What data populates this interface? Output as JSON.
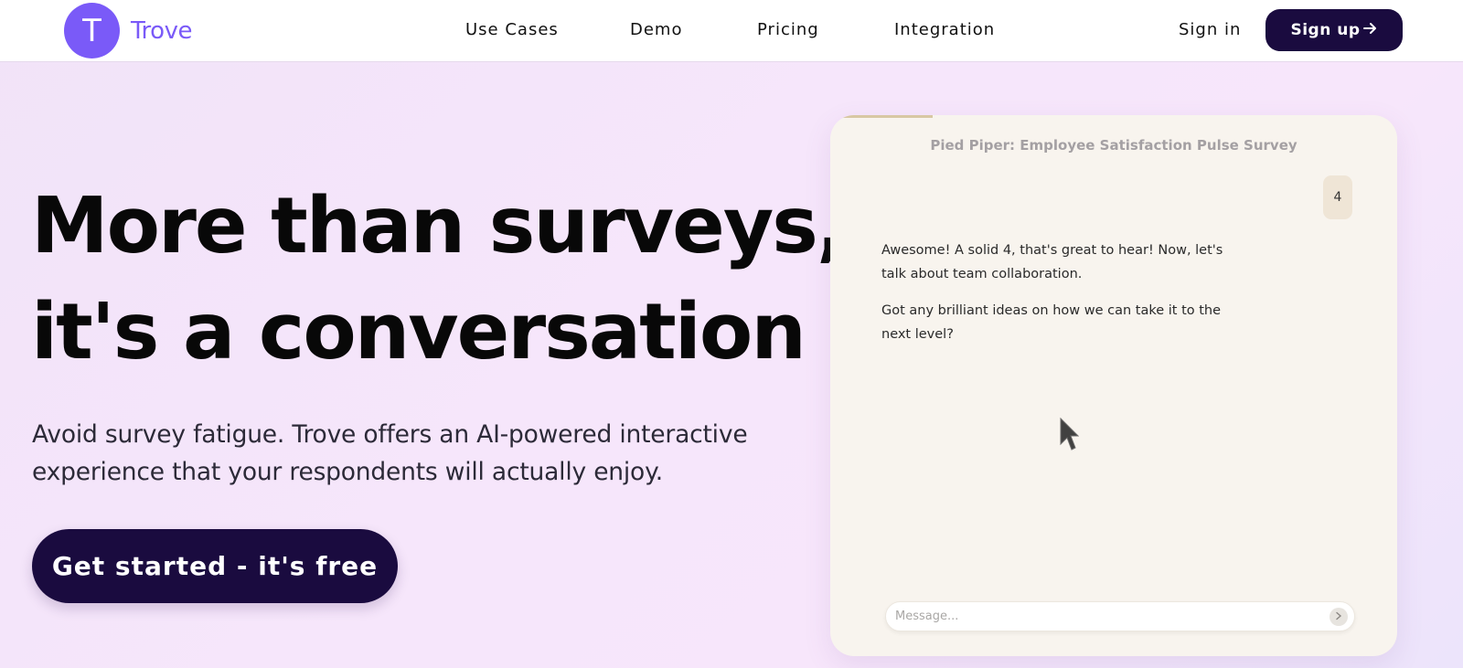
{
  "brand": {
    "logo_letter": "T",
    "name": "Trove",
    "accent": "#7a5af8"
  },
  "nav": {
    "items": [
      {
        "label": "Use Cases"
      },
      {
        "label": "Demo"
      },
      {
        "label": "Pricing"
      },
      {
        "label": "Integration"
      }
    ],
    "signin": "Sign in",
    "signup": "Sign up",
    "signup_icon": "arrow-right-icon"
  },
  "hero": {
    "title_line1": "More than surveys,",
    "title_line2": "it's a conversation",
    "subtitle": "Avoid survey fatigue. Trove offers an AI-powered interactive experience that your respondents will actually enjoy.",
    "cta": "Get started - it's free",
    "cta_color": "#1a0b3f"
  },
  "chat": {
    "survey_title": "Pied Piper: Employee Satisfaction Pulse Survey",
    "progress_fraction": 0.18,
    "user_reply": "4",
    "bot_messages": [
      "Awesome! A solid 4, that's great to hear! Now, let's talk about team collaboration.",
      "Got any brilliant ideas on how we can take it to the next level?"
    ],
    "input_placeholder": "Message...",
    "send_icon": "chevron-right-icon"
  }
}
